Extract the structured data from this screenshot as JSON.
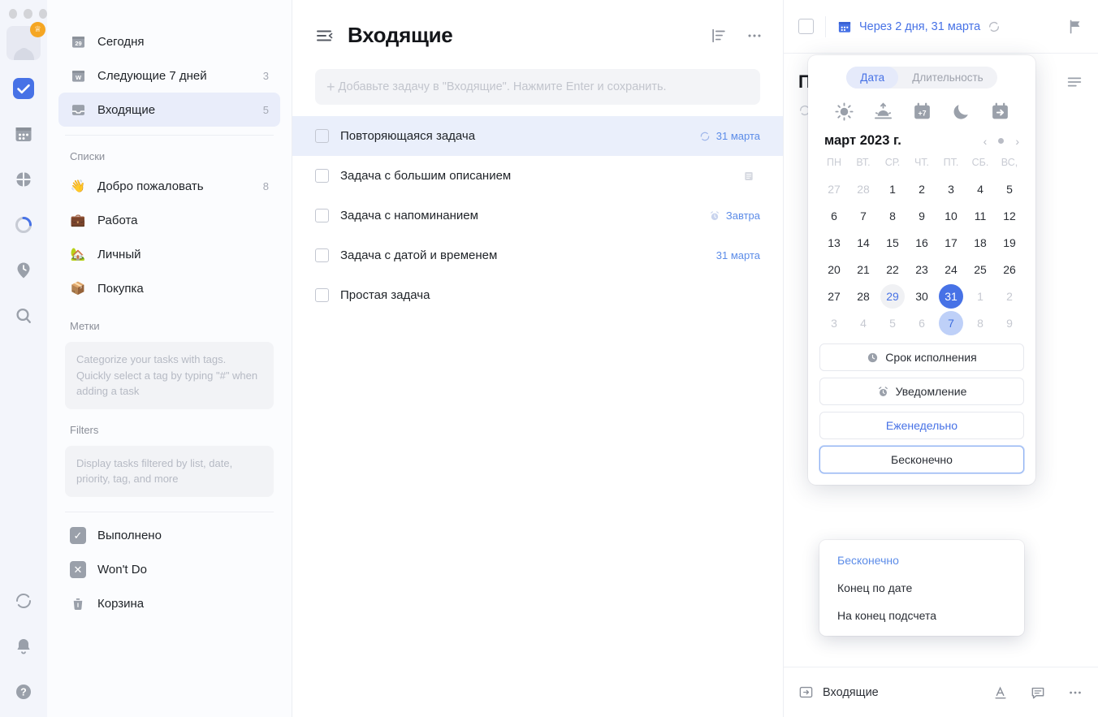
{
  "window": {
    "dots": [
      "close",
      "minimize",
      "maximize"
    ]
  },
  "rail": {
    "avatar_badge": "crown-badge",
    "icons": [
      {
        "name": "tasks-icon",
        "active": true
      },
      {
        "name": "calendar-icon",
        "active": false
      },
      {
        "name": "matrix-icon",
        "active": false
      },
      {
        "name": "habit-ring-icon",
        "active": false
      },
      {
        "name": "pomodoro-icon",
        "active": false
      },
      {
        "name": "search-icon",
        "active": false
      }
    ],
    "bottom_icons": [
      {
        "name": "sync-icon"
      },
      {
        "name": "bell-icon"
      },
      {
        "name": "help-icon"
      }
    ]
  },
  "sidebar": {
    "smart_lists": [
      {
        "label": "Сегодня",
        "icon": "calendar-29-icon",
        "count": ""
      },
      {
        "label": "Следующие 7 дней",
        "icon": "calendar-week-icon",
        "count": "3"
      },
      {
        "label": "Входящие",
        "icon": "inbox-icon",
        "count": "5",
        "selected": true
      }
    ],
    "lists_title": "Списки",
    "lists": [
      {
        "label": "Добро пожаловать",
        "emoji": "👋",
        "count": "8"
      },
      {
        "label": "Работа",
        "emoji": "💼",
        "count": ""
      },
      {
        "label": "Личный",
        "emoji": "🏡",
        "count": ""
      },
      {
        "label": "Покупка",
        "emoji": "📦",
        "count": ""
      }
    ],
    "tags_title": "Метки",
    "tags_hint": "Categorize your tasks with tags. Quickly select a tag by typing \"#\" when adding a task",
    "filters_title": "Filters",
    "filters_hint": "Display tasks filtered by list, date, priority, tag, and more",
    "footer": [
      {
        "label": "Выполнено",
        "icon": "check-square-icon"
      },
      {
        "label": "Won't Do",
        "icon": "x-square-icon"
      },
      {
        "label": "Корзина",
        "icon": "trash-icon"
      }
    ]
  },
  "list_pane": {
    "title": "Входящие",
    "collapse_icon": "collapse-sidebar-icon",
    "sort_icon": "sort-icon",
    "more_icon": "more-horizontal-icon",
    "add_placeholder": "Добавьте задачу в \"Входящие\". Нажмите Enter и сохранить.",
    "tasks": [
      {
        "title": "Повторяющаяся задача",
        "meta": "31 марта",
        "meta_icon": "repeat-icon",
        "selected": true
      },
      {
        "title": "Задача с большим описанием",
        "meta": "",
        "meta_icon": "note-icon",
        "selected": false
      },
      {
        "title": "Задача с напоминанием",
        "meta": "Завтра",
        "meta_icon": "alarm-icon",
        "selected": false
      },
      {
        "title": "Задача с датой и временем",
        "meta": "31 марта",
        "meta_icon": "",
        "selected": false
      },
      {
        "title": "Простая задача",
        "meta": "",
        "meta_icon": "",
        "selected": false
      }
    ]
  },
  "detail": {
    "date_label": "Через 2 дня, 31 марта",
    "date_icon": "calendar-blue-icon",
    "repeat_icon": "repeat-icon",
    "flag_icon": "flag-icon",
    "menu_icon": "description-lines-icon",
    "title": "Повторяющаяся задача",
    "footer_list": "Входящие",
    "footer_list_icon": "move-to-list-icon",
    "footer_icons": [
      {
        "name": "text-format-icon"
      },
      {
        "name": "comment-icon"
      },
      {
        "name": "more-horizontal-icon"
      }
    ]
  },
  "date_popup": {
    "tabs": [
      {
        "label": "Дата",
        "active": true
      },
      {
        "label": "Длительность",
        "active": false
      }
    ],
    "quick_icons": [
      {
        "name": "sun-today-icon"
      },
      {
        "name": "sunrise-tomorrow-icon"
      },
      {
        "name": "calendar-plus7-icon"
      },
      {
        "name": "moon-tonight-icon"
      },
      {
        "name": "calendar-postpone-icon"
      }
    ],
    "month_label": "март 2023 г.",
    "prev_icon": "chevron-left-icon",
    "today-dot": "today-dot-icon",
    "next_icon": "chevron-right-icon",
    "weekdays": [
      "ПН",
      "ВТ.",
      "СР.",
      "ЧТ.",
      "ПТ.",
      "СБ.",
      "ВС,"
    ],
    "days": [
      {
        "d": "27",
        "state": "muted"
      },
      {
        "d": "28",
        "state": "muted"
      },
      {
        "d": "1",
        "state": ""
      },
      {
        "d": "2",
        "state": ""
      },
      {
        "d": "3",
        "state": ""
      },
      {
        "d": "4",
        "state": ""
      },
      {
        "d": "5",
        "state": ""
      },
      {
        "d": "6",
        "state": ""
      },
      {
        "d": "7",
        "state": ""
      },
      {
        "d": "8",
        "state": ""
      },
      {
        "d": "9",
        "state": ""
      },
      {
        "d": "10",
        "state": ""
      },
      {
        "d": "11",
        "state": ""
      },
      {
        "d": "12",
        "state": ""
      },
      {
        "d": "13",
        "state": ""
      },
      {
        "d": "14",
        "state": ""
      },
      {
        "d": "15",
        "state": ""
      },
      {
        "d": "16",
        "state": ""
      },
      {
        "d": "17",
        "state": ""
      },
      {
        "d": "18",
        "state": ""
      },
      {
        "d": "19",
        "state": ""
      },
      {
        "d": "20",
        "state": ""
      },
      {
        "d": "21",
        "state": ""
      },
      {
        "d": "22",
        "state": ""
      },
      {
        "d": "23",
        "state": ""
      },
      {
        "d": "24",
        "state": ""
      },
      {
        "d": "25",
        "state": ""
      },
      {
        "d": "26",
        "state": ""
      },
      {
        "d": "27",
        "state": ""
      },
      {
        "d": "28",
        "state": ""
      },
      {
        "d": "29",
        "state": "today"
      },
      {
        "d": "30",
        "state": ""
      },
      {
        "d": "31",
        "state": "selected"
      },
      {
        "d": "1",
        "state": "muted"
      },
      {
        "d": "2",
        "state": "muted"
      },
      {
        "d": "3",
        "state": "muted"
      },
      {
        "d": "4",
        "state": "muted"
      },
      {
        "d": "5",
        "state": "muted"
      },
      {
        "d": "6",
        "state": "muted"
      },
      {
        "d": "7",
        "state": "hl"
      },
      {
        "d": "8",
        "state": "muted"
      },
      {
        "d": "9",
        "state": "muted"
      }
    ],
    "buttons": [
      {
        "label": "Срок исполнения",
        "icon": "clock-icon",
        "style": "plain"
      },
      {
        "label": "Уведомление",
        "icon": "alarm-icon",
        "style": "plain"
      },
      {
        "label": "Еженедельно",
        "icon": "",
        "style": "link"
      },
      {
        "label": "Бесконечно",
        "icon": "",
        "style": "focused"
      }
    ],
    "dropdown": [
      {
        "label": "Бесконечно",
        "active": true
      },
      {
        "label": "Конец по дате",
        "active": false
      },
      {
        "label": "На конец подсчета",
        "active": false
      }
    ]
  },
  "colors": {
    "accent": "#4772e6",
    "selected_row": "#eaeffb",
    "rail_bg": "#f3f5fb"
  }
}
